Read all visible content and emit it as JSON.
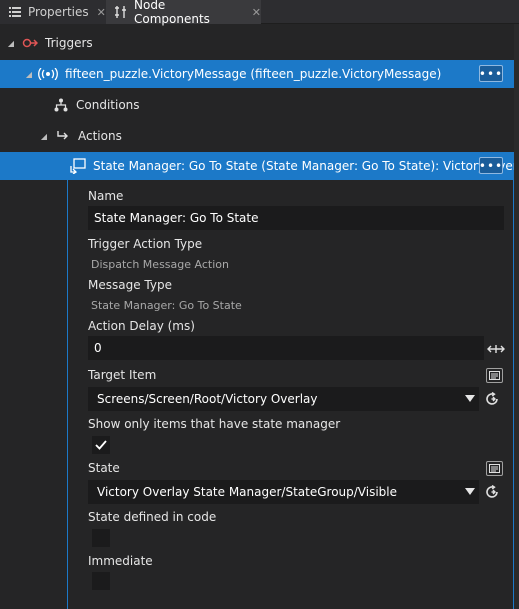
{
  "tabs": [
    {
      "label": "Properties",
      "icon": "properties-list-icon",
      "close": "✕"
    },
    {
      "label": "Node Components",
      "icon": "node-components-icon",
      "close": "✕"
    }
  ],
  "tree": {
    "triggers_label": "Triggers",
    "trigger_item_label": "fifteen_puzzle.VictoryMessage (fifteen_puzzle.VictoryMessage)",
    "conditions_label": "Conditions",
    "actions_label": "Actions",
    "action_item_label": "State Manager: Go To State (State Manager: Go To State): Victory Overlay",
    "more_label": "•••"
  },
  "properties": {
    "name_label": "Name",
    "name_value": "State Manager: Go To State",
    "trigger_action_type_label": "Trigger Action Type",
    "trigger_action_type_value": "Dispatch Message Action",
    "message_type_label": "Message Type",
    "message_type_value": "State Manager: Go To State",
    "action_delay_label": "Action Delay (ms)",
    "action_delay_value": "0",
    "target_item_label": "Target Item",
    "target_item_value": "Screens/Screen/Root/Victory Overlay",
    "show_only_label": "Show only items that have state manager",
    "show_only_checked": true,
    "state_label": "State",
    "state_value": "Victory Overlay State Manager/StateGroup/Visible",
    "state_in_code_label": "State defined in code",
    "state_in_code_checked": false,
    "immediate_label": "Immediate",
    "immediate_checked": false
  },
  "colors": {
    "accent": "#1c79c8",
    "background": "#252526",
    "field": "#1b1b1c",
    "trigger_icon": "#e05555"
  }
}
